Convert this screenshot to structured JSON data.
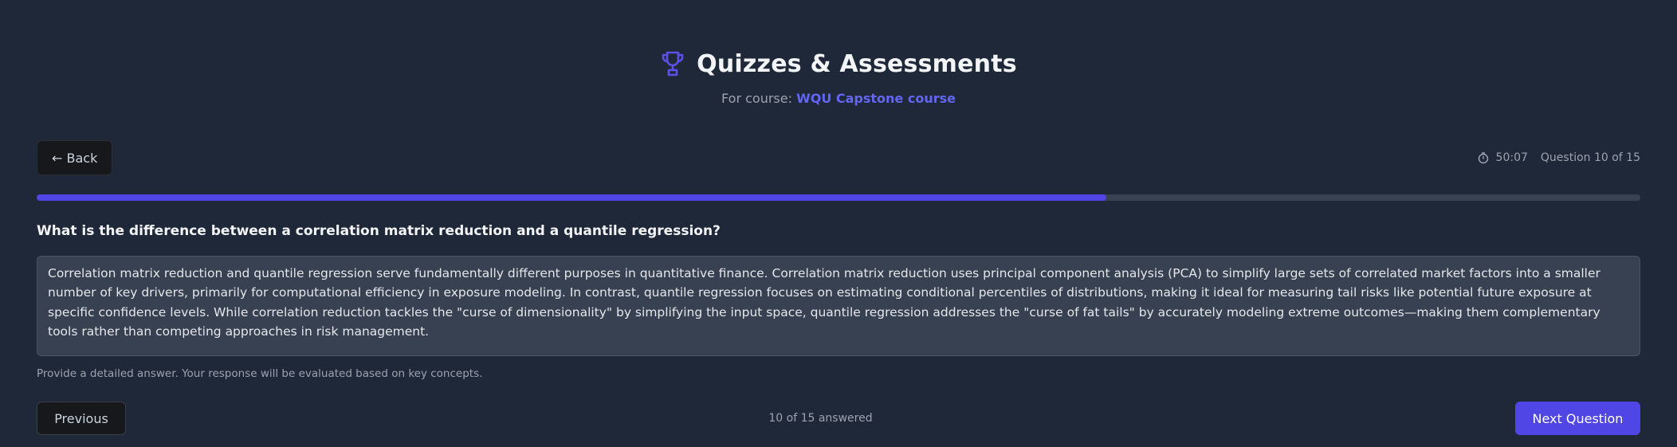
{
  "header": {
    "title": "Quizzes & Assessments",
    "course_prefix": "For course: ",
    "course_name": "WQU Capstone course",
    "icon": "trophy-icon"
  },
  "toolbar": {
    "back_label": "← Back",
    "timer": "50:07",
    "question_counter": "Question 10 of 15"
  },
  "progress": {
    "current": 10,
    "total": 15,
    "fraction": 0.667
  },
  "question": {
    "text": "What is the difference between a correlation matrix reduction and a quantile regression?"
  },
  "answer": {
    "value": "Correlation matrix reduction and quantile regression serve fundamentally different purposes in quantitative finance. Correlation matrix reduction uses principal component analysis (PCA) to simplify large sets of correlated market factors into a smaller number of key drivers, primarily for computational efficiency in exposure modeling. In contrast, quantile regression focuses on estimating conditional percentiles of distributions, making it ideal for measuring tail risks like potential future exposure at specific confidence levels. While correlation reduction tackles the \"curse of dimensionality\" by simplifying the input space, quantile regression addresses the \"curse of fat tails\" by accurately modeling extreme outcomes—making them complementary tools rather than competing approaches in risk management.",
    "hint": "Provide a detailed answer. Your response will be evaluated based on key concepts."
  },
  "footer": {
    "previous_label": "Previous",
    "answered_status": "10 of 15 answered",
    "next_label": "Next Question"
  },
  "colors": {
    "background": "#1f2838",
    "accent": "#4f46e5",
    "progress_track": "#374151"
  }
}
